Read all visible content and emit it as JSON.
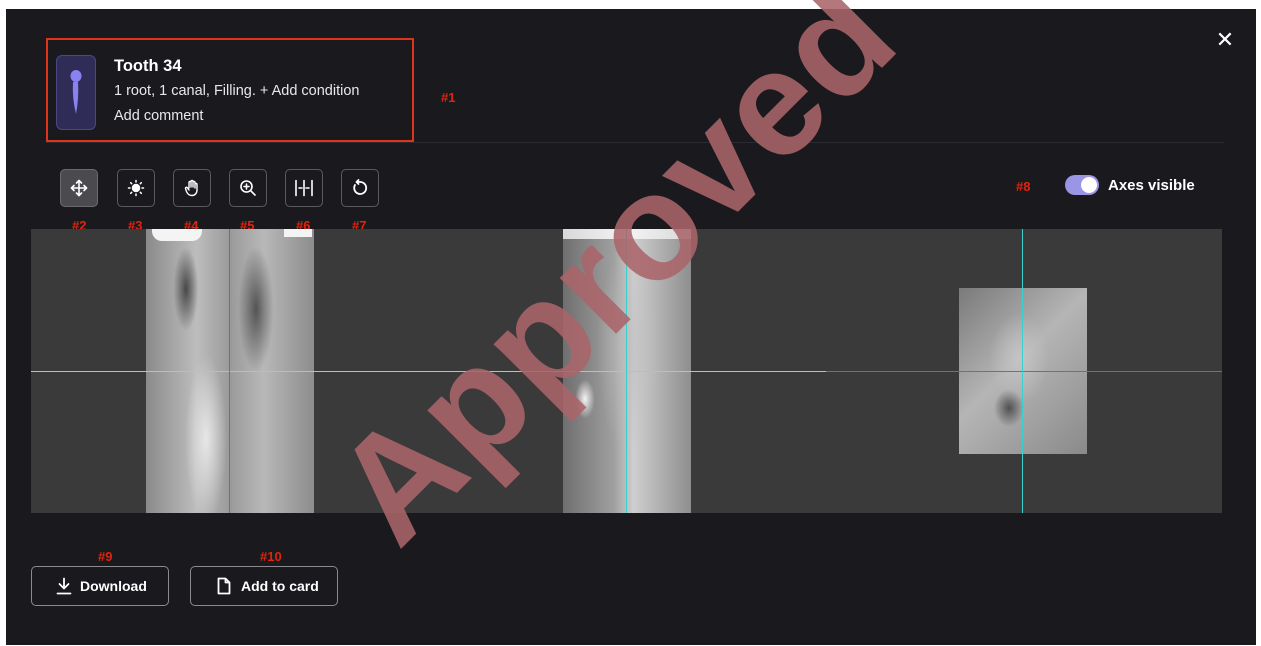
{
  "modal": {
    "close_label": "✕"
  },
  "tooth": {
    "title": "Tooth 34",
    "description": "1 root, 1 canal, Filling.",
    "add_condition": "+ Add condition",
    "comment": "Add comment"
  },
  "labels": {
    "header": "#1",
    "move": "#2",
    "brightness": "#3",
    "pan": "#4",
    "zoom": "#5",
    "split": "#6",
    "rotate": "#7",
    "axes": "#8",
    "download": "#9",
    "add_to_card": "#10"
  },
  "toolbar": {
    "tools": [
      {
        "name": "move",
        "icon": "move-arrows-icon",
        "active": true
      },
      {
        "name": "brightness",
        "icon": "brightness-icon",
        "active": false
      },
      {
        "name": "pan",
        "icon": "hand-icon",
        "active": false
      },
      {
        "name": "zoom",
        "icon": "zoom-in-icon",
        "active": false
      },
      {
        "name": "split",
        "icon": "split-view-icon",
        "active": false
      },
      {
        "name": "rotate",
        "icon": "rotate-icon",
        "active": false
      }
    ]
  },
  "axes_toggle": {
    "label": "Axes visible",
    "checked": true,
    "color": "#9b95e6"
  },
  "actions": {
    "download_label": "Download",
    "add_to_card_label": "Add to card"
  },
  "watermark": {
    "text": "Approved"
  },
  "colors": {
    "background": "#1a1a1e",
    "highlight_border": "#e0331b",
    "annotation_red": "#e0240e",
    "axis_yellow": "#cfcf2e",
    "axis_magenta": "#c23ac2",
    "axis_cyan": "#3ad0d0",
    "tooth_badge": "#2f2d58"
  }
}
